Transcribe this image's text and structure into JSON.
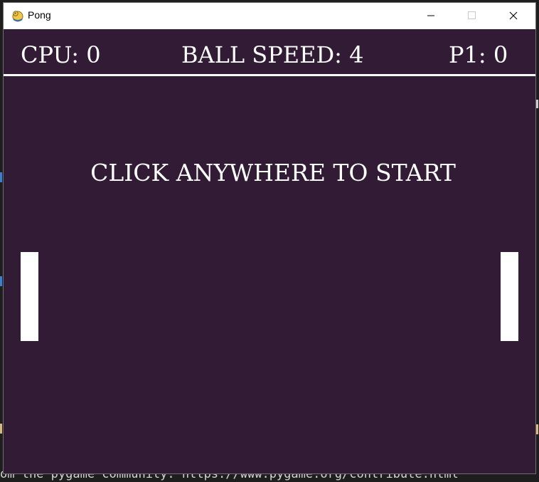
{
  "window": {
    "title": "Pong"
  },
  "hud": {
    "cpu_label": "CPU: 0",
    "ball_speed_label": "BALL SPEED: 4",
    "p1_label": "P1: 0"
  },
  "game": {
    "start_message": "CLICK ANYWHERE TO START"
  },
  "background": {
    "code_line": "om the pygame community. https://www.pygame.org/contribute.html"
  },
  "colors": {
    "game_background": "#321b34",
    "foreground": "#ffffff"
  },
  "icons": {
    "app": "pygame-snake-icon",
    "minimize": "minimize-icon",
    "maximize": "maximize-icon",
    "close": "close-icon"
  }
}
